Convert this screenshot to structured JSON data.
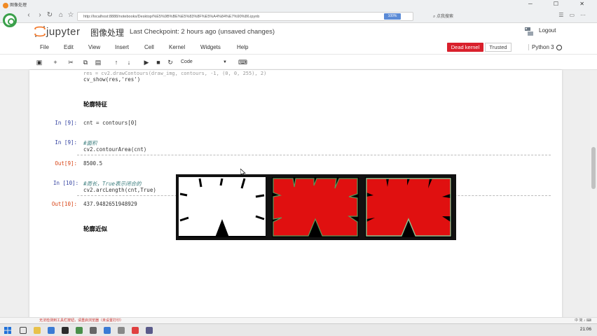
{
  "browser": {
    "tab_title": "图像处理",
    "url": "http://localhost:8888/notebooks/Desktop/%E5%9B%BE%E5%83%8F%E5%A4%84%E7%90%86.ipynb",
    "url_chip": "100%",
    "search_label": "点我搜索"
  },
  "header": {
    "logo_text": "jupyter",
    "notebook_title": "图像处理",
    "checkpoint": "Last Checkpoint: 2 hours ago (unsaved changes)",
    "logout": "Logout"
  },
  "menu": {
    "items": [
      "File",
      "Edit",
      "View",
      "Insert",
      "Cell",
      "Kernel",
      "Widgets",
      "Help"
    ],
    "kernel_status": "Dead kernel",
    "trusted": "Trusted",
    "kernel_name": "Python 3"
  },
  "toolbar": {
    "cell_type": "Code"
  },
  "cells": {
    "top_code": "cv_show(res,'res')",
    "heading1": "轮廓特征",
    "in9_prompt": "In [9]:",
    "in9_code": "cnt = contours[0]",
    "in9b_prompt": "In [9]:",
    "in9b_comment": "#面积",
    "in9b_code": "cv2.contourArea(cnt)",
    "out9_prompt": "Out[9]:",
    "out9_value": "8500.5",
    "in10_prompt": "In [10]:",
    "in10_comment": "#周长，True表示闭合的",
    "in10_code": "cv2.arcLength(cnt,True)",
    "out10_prompt": "Out[10]:",
    "out10_value": "437.9482651948929",
    "heading2": "轮廓近似"
  },
  "status": {
    "left_text": "无法检测到工具栏按钮，请重启浏览器（未设置打印）",
    "right_text": "中 简 ♪ ⌨"
  },
  "taskbar": {
    "time": "21:06"
  },
  "colors": {
    "kernel_badge": "#d9202c",
    "jupyter_orange": "#f37626",
    "out_prompt": "#d84315",
    "in_prompt": "#303f9f",
    "contour_red": "#e01010"
  }
}
